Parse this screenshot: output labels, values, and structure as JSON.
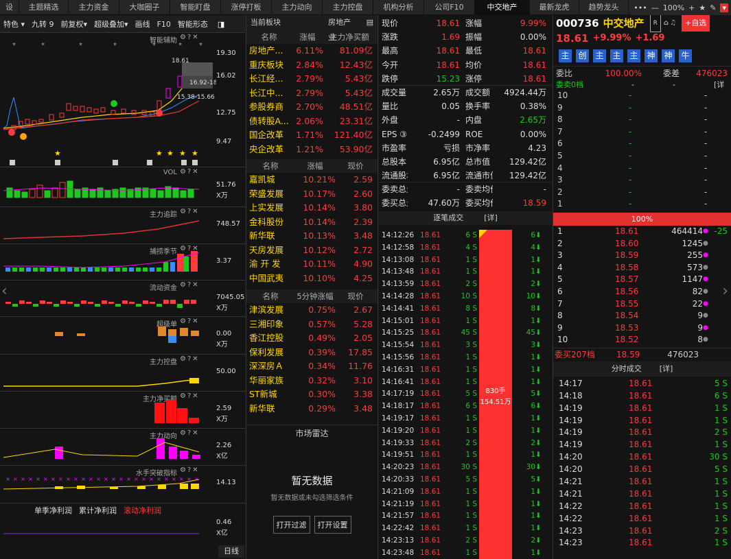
{
  "tabs": [
    "设",
    "主题精选",
    "主力资金",
    "大咖圈子",
    "智能盯盘",
    "涨停打板",
    "主力动向",
    "主力控盘",
    "机构分析",
    "公司F10",
    "中交地产",
    "最新龙虎",
    "趋势龙头"
  ],
  "tab_active_index": 10,
  "tab_tools": {
    "more": "•••",
    "zoom_out": "—",
    "zoom": "100%",
    "zoom_in": "+",
    "star": "★",
    "edit": "✎",
    "menu": "▾"
  },
  "toolbar": {
    "items": [
      "特色 ▾",
      "九转 9",
      "前复权▾",
      "超级叠加▾",
      "画线",
      "F10",
      "智能形态"
    ],
    "toggle": "◨"
  },
  "chart_panels": [
    {
      "title": "智能辅助",
      "axis": [
        "19.30",
        "16.02",
        "12.75",
        "9.47"
      ],
      "overlay": [
        "18.61",
        "16.92-18",
        "15.38-15.66"
      ]
    },
    {
      "title": "VOL",
      "axis": [
        "51.76",
        "X万"
      ]
    },
    {
      "title": "主力追踪",
      "axis": [
        "748.57"
      ]
    },
    {
      "title": "捕捞季节",
      "axis": [
        "3.37"
      ]
    },
    {
      "title": "流动资金",
      "axis": [
        "7045.05",
        "X万"
      ]
    },
    {
      "title": "超级单",
      "axis": [
        "0.00",
        "X万"
      ]
    },
    {
      "title": "主力控盘",
      "axis": [
        "50.00"
      ]
    },
    {
      "title": "主力净买额",
      "axis": [
        "2.59",
        "X万"
      ]
    },
    {
      "title": "主力动向",
      "axis": [
        "2.26",
        "X亿"
      ]
    },
    {
      "title": "水手突破指标",
      "axis": [
        "14.13"
      ]
    },
    {
      "title": "",
      "axis": [
        "0.46",
        "X亿"
      ]
    }
  ],
  "profit_legend": [
    "单季净利润",
    "累计净利润",
    "滚动净利润"
  ],
  "bottom_period": "日线",
  "sector": {
    "tab_left": "当前板块",
    "tab_right": "房地产业",
    "t1_headers": [
      "名称",
      "涨幅",
      "主力净买额"
    ],
    "t1": [
      [
        "房地产...",
        "6.11%",
        "81.09亿"
      ],
      [
        "重庆板块",
        "2.84%",
        "12.43亿"
      ],
      [
        "长江经...",
        "2.79%",
        "5.43亿"
      ],
      [
        "长江中...",
        "2.79%",
        "5.43亿"
      ],
      [
        "参股券商",
        "2.70%",
        "48.51亿"
      ],
      [
        "债转股A...",
        "2.06%",
        "23.31亿"
      ],
      [
        "国企改革",
        "1.71%",
        "121.40亿"
      ],
      [
        "央企改革",
        "1.21%",
        "53.90亿"
      ]
    ],
    "t2_headers": [
      "名称",
      "涨幅",
      "现价"
    ],
    "t2": [
      [
        "嘉凯城",
        "10.21%",
        "2.59"
      ],
      [
        "荣盛发展",
        "10.17%",
        "2.60"
      ],
      [
        "上实发展",
        "10.14%",
        "3.80"
      ],
      [
        "金科股份",
        "10.14%",
        "2.39"
      ],
      [
        "新华联",
        "10.13%",
        "3.48"
      ],
      [
        "天房发展",
        "10.12%",
        "2.72"
      ],
      [
        "渝 开 发",
        "10.11%",
        "4.90"
      ],
      [
        "中国武夷",
        "10.10%",
        "4.25"
      ]
    ],
    "t3_headers": [
      "名称",
      "5分钟涨幅",
      "现价"
    ],
    "t3": [
      [
        "津滨发展",
        "0.75%",
        "2.67"
      ],
      [
        "三湘印象",
        "0.57%",
        "5.28"
      ],
      [
        "香江控股",
        "0.49%",
        "2.05"
      ],
      [
        "保利发展",
        "0.39%",
        "17.85"
      ],
      [
        "深深房Ａ",
        "0.34%",
        "11.76"
      ],
      [
        "华丽家族",
        "0.32%",
        "3.10"
      ],
      [
        "ST新城",
        "0.30%",
        "3.38"
      ],
      [
        "新华联",
        "0.29%",
        "3.48"
      ]
    ],
    "radar_title": "市场雷达",
    "empty_title": "暂无数据",
    "empty_desc": "暂无数据或未勾选筛选条件",
    "btn_filter": "打开过滤",
    "btn_settings": "打开设置"
  },
  "quote": [
    [
      [
        "现价",
        "18.61",
        "red"
      ],
      [
        "涨幅",
        "9.99%",
        "red"
      ]
    ],
    [
      [
        "涨跌",
        "1.69",
        "red"
      ],
      [
        "振幅",
        "0.00%",
        "wht"
      ]
    ],
    [
      [
        "最高",
        "18.61",
        "red"
      ],
      [
        "最低",
        "18.61",
        "red"
      ]
    ],
    [
      [
        "今开",
        "18.61",
        "red"
      ],
      [
        "均价",
        "18.61",
        "red"
      ]
    ],
    [
      [
        "跌停",
        "15.23",
        "grn"
      ],
      [
        "涨停",
        "18.61",
        "red"
      ]
    ],
    [
      [
        "成交量",
        "2.65万",
        "wht"
      ],
      [
        "成交额",
        "4924.44万",
        "wht"
      ]
    ],
    [
      [
        "量比",
        "0.05",
        "wht"
      ],
      [
        "换手率",
        "0.38%",
        "wht"
      ]
    ],
    [
      [
        "外盘",
        "-",
        "wht"
      ],
      [
        "内盘",
        "2.65万",
        "grn"
      ]
    ],
    [
      [
        "EPS ③",
        "-0.2499",
        "wht"
      ],
      [
        "ROE",
        "0.00%",
        "wht"
      ]
    ],
    [
      [
        "市盈率",
        "亏损",
        "wht"
      ],
      [
        "市净率",
        "4.23",
        "wht"
      ]
    ],
    [
      [
        "总股本",
        "6.95亿",
        "wht"
      ],
      [
        "总市值",
        "129.42亿",
        "wht"
      ]
    ],
    [
      [
        "流通股本",
        "6.95亿",
        "wht"
      ],
      [
        "流通市值",
        "129.42亿",
        "wht"
      ]
    ],
    [
      [
        "委卖总量",
        "-",
        "wht"
      ],
      [
        "委卖均价",
        "-",
        "wht"
      ]
    ],
    [
      [
        "委买总量",
        "47.60万",
        "wht"
      ],
      [
        "委买均价",
        "18.59",
        "red"
      ]
    ]
  ],
  "trades_title": "逐笔成交",
  "trades_detail": "[详]",
  "trades": [
    [
      "14:12:26",
      "18.61",
      "6 S",
      "6"
    ],
    [
      "14:12:58",
      "18.61",
      "4 S",
      "4"
    ],
    [
      "14:13:08",
      "18.61",
      "1 S",
      "1"
    ],
    [
      "14:13:48",
      "18.61",
      "1 S",
      "1"
    ],
    [
      "14:13:59",
      "18.61",
      "2 S",
      "2"
    ],
    [
      "14:14:28",
      "18.61",
      "10 S",
      "10"
    ],
    [
      "14:14:41",
      "18.61",
      "8 S",
      "8"
    ],
    [
      "14:15:01",
      "18.61",
      "1 S",
      "1"
    ],
    [
      "14:15:25",
      "18.61",
      "45 S",
      "45"
    ],
    [
      "14:15:54",
      "18.61",
      "3 S",
      "3"
    ],
    [
      "14:15:56",
      "18.61",
      "1 S",
      "1"
    ],
    [
      "14:16:31",
      "18.61",
      "1 S",
      "1"
    ],
    [
      "14:16:41",
      "18.61",
      "1 S",
      "1"
    ],
    [
      "14:17:19",
      "18.61",
      "5 S",
      "5"
    ],
    [
      "14:18:17",
      "18.61",
      "6 S",
      "6"
    ],
    [
      "14:19:17",
      "18.61",
      "1 S",
      "1"
    ],
    [
      "14:19:20",
      "18.61",
      "1 S",
      "1"
    ],
    [
      "14:19:33",
      "18.61",
      "2 S",
      "2"
    ],
    [
      "14:19:51",
      "18.61",
      "1 S",
      "1"
    ],
    [
      "14:20:23",
      "18.61",
      "30 S",
      "30"
    ],
    [
      "14:20:33",
      "18.61",
      "5 S",
      "5"
    ],
    [
      "14:21:09",
      "18.61",
      "1 S",
      "1"
    ],
    [
      "14:21:19",
      "18.61",
      "1 S",
      "1"
    ],
    [
      "14:21:57",
      "18.61",
      "1 S",
      "1"
    ],
    [
      "14:22:42",
      "18.61",
      "1 S",
      "1"
    ],
    [
      "14:23:13",
      "18.61",
      "2 S",
      "2"
    ],
    [
      "14:23:48",
      "18.61",
      "1 S",
      "1"
    ]
  ],
  "trade_bar_label": [
    "830手",
    "154.51万"
  ],
  "stock": {
    "code": "000736",
    "name": "中交地产",
    "tag": "R",
    "add_btn": "+自选",
    "price": "18.61",
    "pct": "+9.99%",
    "chg": "+1.69",
    "badges": [
      "主",
      "创",
      "主",
      "主",
      "主",
      "神",
      "神",
      "牛"
    ]
  },
  "orderbook": {
    "weibi_label": "委比",
    "weibi": "100.00%",
    "weicha_label": "委差",
    "weicha": "476023",
    "sell_header": "委卖0档",
    "sell_levels": [
      "10",
      "9",
      "8",
      "7",
      "6",
      "5",
      "4",
      "3",
      "2",
      "1"
    ],
    "bar_label": "100%",
    "buys": [
      [
        "1",
        "18.61",
        "464414",
        "-25"
      ],
      [
        "2",
        "18.60",
        "1245",
        ""
      ],
      [
        "3",
        "18.59",
        "255",
        ""
      ],
      [
        "4",
        "18.58",
        "573",
        ""
      ],
      [
        "5",
        "18.57",
        "1147",
        ""
      ],
      [
        "6",
        "18.56",
        "82",
        ""
      ],
      [
        "7",
        "18.55",
        "22",
        ""
      ],
      [
        "8",
        "18.54",
        "9",
        ""
      ],
      [
        "9",
        "18.53",
        "9",
        ""
      ],
      [
        "10",
        "18.52",
        "8",
        ""
      ]
    ],
    "buy_total_label": "委买207档",
    "buy_total_price": "18.59",
    "buy_total_vol": "476023"
  },
  "minute_title": "分时成交",
  "minute_detail": "[详]",
  "minutes": [
    [
      "14:17",
      "18.61",
      "5 S"
    ],
    [
      "14:18",
      "18.61",
      "6 S"
    ],
    [
      "14:19",
      "18.61",
      "1 S"
    ],
    [
      "14:19",
      "18.61",
      "1 S"
    ],
    [
      "14:19",
      "18.61",
      "2 S"
    ],
    [
      "14:19",
      "18.61",
      "1 S"
    ],
    [
      "14:20",
      "18.61",
      "30 S"
    ],
    [
      "14:20",
      "18.61",
      "5 S"
    ],
    [
      "14:21",
      "18.61",
      "1 S"
    ],
    [
      "14:21",
      "18.61",
      "1 S"
    ],
    [
      "14:22",
      "18.61",
      "1 S"
    ],
    [
      "14:22",
      "18.61",
      "1 S"
    ],
    [
      "14:23",
      "18.61",
      "2 S"
    ],
    [
      "14:23",
      "18.61",
      "1 S"
    ]
  ]
}
